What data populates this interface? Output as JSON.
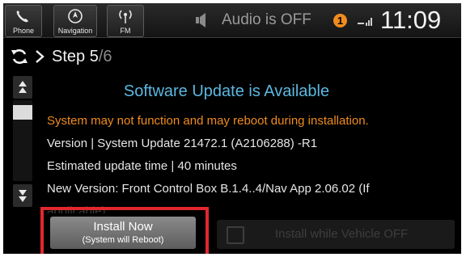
{
  "status_bar": {
    "phone_label": "Phone",
    "navigation_label": "Navigation",
    "fm_label": "FM",
    "audio_status": "Audio is OFF",
    "notification_count": "1",
    "clock": "11:09",
    "icons": [
      "phone-icon",
      "compass-icon",
      "radio-icon",
      "speaker-muted-icon",
      "signal-icon"
    ]
  },
  "header": {
    "step_current": "Step 5",
    "step_total": "/6",
    "icons": [
      "refresh-icon",
      "chevron-right-icon"
    ]
  },
  "content": {
    "title": "Software Update is Available",
    "warning": "System may not function and may reboot during installation.",
    "version": "Version | System Update 21472.1 (A2106288) -R1",
    "estimated_time": "Estimated update time | 40 minutes",
    "new_version": "New Version:  Front Control Box B.1.4..4/Nav App 2.06.02 (If",
    "new_version_cont": "applicable)"
  },
  "buttons": {
    "install_now": "Install Now",
    "install_now_note": "(System will Reboot)",
    "install_while_off": "Install while Vehicle OFF"
  },
  "colors": {
    "title": "#5cb8e0",
    "warning": "#f08c1e",
    "badge": "#f08c1e",
    "highlight": "#e0282e"
  }
}
